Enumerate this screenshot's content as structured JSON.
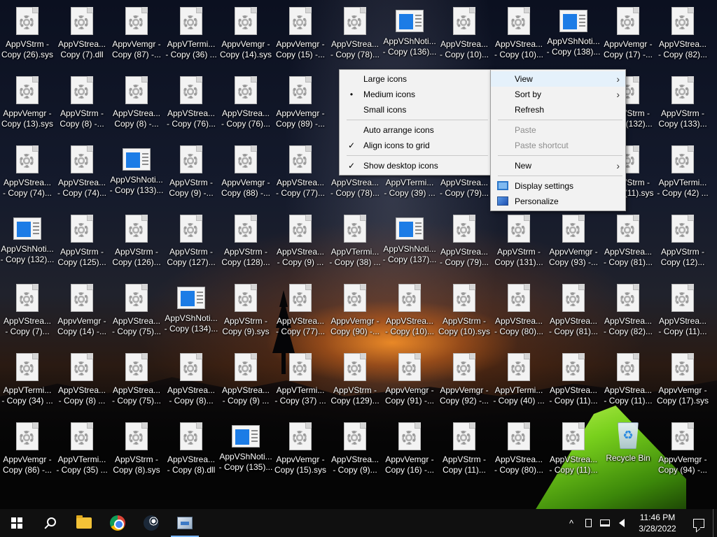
{
  "desktop": {
    "rows": [
      [
        {
          "l1": "AppVStrm -",
          "l2": "Copy (26).sys",
          "type": "file"
        },
        {
          "l1": "AppVStrea...",
          "l2": "Copy (7).dll",
          "type": "file"
        },
        {
          "l1": "AppvVemgr -",
          "l2": "Copy (87) -...",
          "type": "file"
        },
        {
          "l1": "AppVTermi...",
          "l2": "- Copy (36) ...",
          "type": "file"
        },
        {
          "l1": "AppvVemgr -",
          "l2": "Copy (14).sys",
          "type": "file"
        },
        {
          "l1": "AppvVemgr -",
          "l2": "Copy (15) -...",
          "type": "file"
        },
        {
          "l1": "AppVStrea...",
          "l2": "- Copy (78)...",
          "type": "file"
        },
        {
          "l1": "AppVShNoti...",
          "l2": "- Copy (136)...",
          "type": "app"
        },
        {
          "l1": "AppVStrea...",
          "l2": "- Copy (10)...",
          "type": "file"
        },
        {
          "l1": "AppVStrea...",
          "l2": "- Copy (10)...",
          "type": "file"
        },
        {
          "l1": "AppVShNoti...",
          "l2": "- Copy (138)...",
          "type": "app"
        },
        {
          "l1": "AppvVemgr -",
          "l2": "Copy (17) -...",
          "type": "file"
        },
        {
          "l1": "AppVStrea...",
          "l2": "- Copy (82)...",
          "type": "file"
        }
      ],
      [
        {
          "l1": "AppvVemgr -",
          "l2": "Copy (13).sys",
          "type": "file"
        },
        {
          "l1": "AppVStrm -",
          "l2": "Copy (8) -...",
          "type": "file"
        },
        {
          "l1": "AppVStrea...",
          "l2": "Copy (8) -...",
          "type": "file"
        },
        {
          "l1": "AppVStrea...",
          "l2": "- Copy (76)...",
          "type": "file"
        },
        {
          "l1": "AppVStrea...",
          "l2": "- Copy (76)...",
          "type": "file"
        },
        {
          "l1": "AppvVemgr -",
          "l2": "Copy (89) -...",
          "type": "file"
        },
        {
          "l1": "",
          "l2": "",
          "type": "hidden"
        },
        {
          "l1": "",
          "l2": "",
          "type": "hidden"
        },
        {
          "l1": "",
          "l2": "",
          "type": "hidden"
        },
        {
          "l1": "",
          "l2": "",
          "type": "hidden"
        },
        {
          "l1": "",
          "l2": "",
          "type": "hidden"
        },
        {
          "l1": "AppVStrm -",
          "l2": "Copy (132)...",
          "type": "file"
        },
        {
          "l1": "AppVStrm -",
          "l2": "Copy (133)...",
          "type": "file"
        }
      ],
      [
        {
          "l1": "AppVStrea...",
          "l2": "- Copy (74)...",
          "type": "file"
        },
        {
          "l1": "AppVStrea...",
          "l2": "- Copy (74)...",
          "type": "file"
        },
        {
          "l1": "AppVShNoti...",
          "l2": "- Copy (133)...",
          "type": "app"
        },
        {
          "l1": "AppVStrm -",
          "l2": "Copy (9) -...",
          "type": "file"
        },
        {
          "l1": "AppvVemgr -",
          "l2": "Copy (88) -...",
          "type": "file"
        },
        {
          "l1": "AppVStrea...",
          "l2": "- Copy (77)...",
          "type": "file"
        },
        {
          "l1": "AppVStrea...",
          "l2": "- Copy (78)...",
          "type": "file"
        },
        {
          "l1": "AppVTermi...",
          "l2": "- Copy (39) ...",
          "type": "file"
        },
        {
          "l1": "AppVStrea...",
          "l2": "- Copy (79)...",
          "type": "file"
        },
        {
          "l1": "",
          "l2": "",
          "type": "hidden"
        },
        {
          "l1": "",
          "l2": "",
          "type": "hidden"
        },
        {
          "l1": "AppVStrm -",
          "l2": "Copy (11).sys",
          "type": "file"
        },
        {
          "l1": "AppVTermi...",
          "l2": "- Copy (42) ...",
          "type": "file"
        }
      ],
      [
        {
          "l1": "AppVShNoti...",
          "l2": "- Copy (132)...",
          "type": "app"
        },
        {
          "l1": "AppVStrm -",
          "l2": "Copy (125)...",
          "type": "file"
        },
        {
          "l1": "AppVStrm -",
          "l2": "Copy (126)...",
          "type": "file"
        },
        {
          "l1": "AppVStrm -",
          "l2": "Copy (127)...",
          "type": "file"
        },
        {
          "l1": "AppVStrm -",
          "l2": "Copy (128)...",
          "type": "file"
        },
        {
          "l1": "AppVStrea...",
          "l2": "- Copy (9) ...",
          "type": "file"
        },
        {
          "l1": "AppVTermi...",
          "l2": "- Copy (38) ...",
          "type": "file"
        },
        {
          "l1": "AppVShNoti...",
          "l2": "- Copy (137)...",
          "type": "app"
        },
        {
          "l1": "AppVStrea...",
          "l2": "- Copy (79)...",
          "type": "file"
        },
        {
          "l1": "AppVStrm -",
          "l2": "Copy (131)...",
          "type": "file"
        },
        {
          "l1": "AppvVemgr -",
          "l2": "Copy (93) -...",
          "type": "file"
        },
        {
          "l1": "AppVStrea...",
          "l2": "- Copy (81)...",
          "type": "file"
        },
        {
          "l1": "AppVStrm -",
          "l2": "Copy (12)...",
          "type": "file"
        }
      ],
      [
        {
          "l1": "AppVStrea...",
          "l2": "- Copy (7)...",
          "type": "file"
        },
        {
          "l1": "AppvVemgr -",
          "l2": "Copy (14) -...",
          "type": "file"
        },
        {
          "l1": "AppVStrea...",
          "l2": "- Copy (75)...",
          "type": "file"
        },
        {
          "l1": "AppVShNoti...",
          "l2": "- Copy (134)...",
          "type": "app"
        },
        {
          "l1": "AppVStrm -",
          "l2": "Copy (9).sys",
          "type": "file"
        },
        {
          "l1": "AppVStrea...",
          "l2": "- Copy (77)...",
          "type": "file"
        },
        {
          "l1": "AppvVemgr -",
          "l2": "Copy (90) -...",
          "type": "file"
        },
        {
          "l1": "AppVStrea...",
          "l2": "- Copy (10)...",
          "type": "file"
        },
        {
          "l1": "AppVStrm -",
          "l2": "Copy (10).sys",
          "type": "file"
        },
        {
          "l1": "AppVStrea...",
          "l2": "- Copy (80)...",
          "type": "file"
        },
        {
          "l1": "AppVStrea...",
          "l2": "- Copy (81)...",
          "type": "file"
        },
        {
          "l1": "AppVStrea...",
          "l2": "- Copy (82)...",
          "type": "file"
        },
        {
          "l1": "AppVStrea...",
          "l2": "- Copy (11)...",
          "type": "file"
        }
      ],
      [
        {
          "l1": "AppVTermi...",
          "l2": "- Copy (34) ...",
          "type": "file"
        },
        {
          "l1": "AppVStrea...",
          "l2": "- Copy (8) ...",
          "type": "file"
        },
        {
          "l1": "AppVStrea...",
          "l2": "- Copy (75)...",
          "type": "file"
        },
        {
          "l1": "AppVStrea...",
          "l2": "- Copy (8)...",
          "type": "file"
        },
        {
          "l1": "AppVStrea...",
          "l2": "- Copy (9) ...",
          "type": "file"
        },
        {
          "l1": "AppVTermi...",
          "l2": "- Copy (37) ...",
          "type": "file"
        },
        {
          "l1": "AppVStrm -",
          "l2": "Copy (129)...",
          "type": "file"
        },
        {
          "l1": "AppvVemgr -",
          "l2": "Copy (91) -...",
          "type": "file"
        },
        {
          "l1": "AppvVemgr -",
          "l2": "Copy (92) -...",
          "type": "file"
        },
        {
          "l1": "AppVTermi...",
          "l2": "- Copy (40) ...",
          "type": "file"
        },
        {
          "l1": "AppVStrea...",
          "l2": "- Copy (11)...",
          "type": "file"
        },
        {
          "l1": "AppVStrea...",
          "l2": "- Copy (11)...",
          "type": "file"
        },
        {
          "l1": "AppvVemgr -",
          "l2": "Copy (17).sys",
          "type": "file"
        }
      ],
      [
        {
          "l1": "AppvVemgr -",
          "l2": "Copy (86) -...",
          "type": "file"
        },
        {
          "l1": "AppVTermi...",
          "l2": "- Copy (35) ...",
          "type": "file"
        },
        {
          "l1": "AppVStrm -",
          "l2": "Copy (8).sys",
          "type": "file"
        },
        {
          "l1": "AppVStrea...",
          "l2": "- Copy (8).dll",
          "type": "file"
        },
        {
          "l1": "AppVShNoti...",
          "l2": "- Copy (135)...",
          "type": "app"
        },
        {
          "l1": "AppvVemgr -",
          "l2": "Copy (15).sys",
          "type": "file"
        },
        {
          "l1": "AppVStrea...",
          "l2": "- Copy (9)...",
          "type": "file"
        },
        {
          "l1": "AppvVemgr -",
          "l2": "Copy (16) -...",
          "type": "file"
        },
        {
          "l1": "AppVStrm -",
          "l2": "Copy (11)...",
          "type": "file"
        },
        {
          "l1": "AppVStrea...",
          "l2": "- Copy (80)...",
          "type": "file"
        },
        {
          "l1": "AppVStrea...",
          "l2": "- Copy (11)...",
          "type": "file"
        },
        {
          "l1": "Recycle Bin",
          "l2": "",
          "type": "bin"
        },
        {
          "l1": "AppvVemgr -",
          "l2": "Copy (94) -...",
          "type": "file"
        }
      ]
    ]
  },
  "view_menu": {
    "items": [
      {
        "label": "Large icons",
        "mark": "",
        "sep_after": false
      },
      {
        "label": "Medium icons",
        "mark": "•",
        "sep_after": false
      },
      {
        "label": "Small icons",
        "mark": "",
        "sep_after": true
      },
      {
        "label": "Auto arrange icons",
        "mark": "",
        "sep_after": false
      },
      {
        "label": "Align icons to grid",
        "mark": "✓",
        "sep_after": true
      },
      {
        "label": "Show desktop icons",
        "mark": "✓",
        "sep_after": false
      }
    ]
  },
  "main_menu": {
    "view": "View",
    "sort_by": "Sort by",
    "refresh": "Refresh",
    "paste": "Paste",
    "paste_shortcut": "Paste shortcut",
    "new": "New",
    "display_settings": "Display settings",
    "personalize": "Personalize",
    "arrow": "›"
  },
  "taskbar": {
    "time": "11:46 PM",
    "date": "3/28/2022",
    "tray_chevron": "^"
  },
  "colors": {
    "menu_bg": "#f2f2f2",
    "menu_highlight": "#e5f1fb",
    "taskbar_bg": "#101010",
    "accent": "#7ab6ff"
  }
}
